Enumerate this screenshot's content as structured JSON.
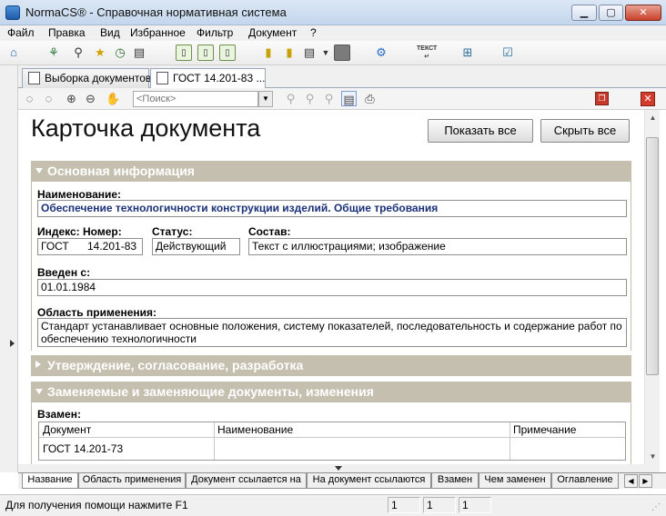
{
  "window": {
    "title": "NormaCS® - Справочная нормативная система",
    "minimize_glyph": "▁",
    "maximize_glyph": "▢",
    "close_glyph": "✕"
  },
  "menu": [
    "Файл",
    "Правка",
    "Вид",
    "Избранное",
    "Фильтр",
    "Документ",
    "?"
  ],
  "toolbar": {
    "text_button_label": "ТЕКСТ"
  },
  "tabs": [
    {
      "label": "Выборка документов",
      "active": false
    },
    {
      "label": "ГОСТ 14.201-83 ...",
      "active": true
    }
  ],
  "doc_toolbar": {
    "search_placeholder": "<Поиск>"
  },
  "card": {
    "title": "Карточка документа",
    "show_all_label": "Показать все",
    "hide_all_label": "Скрыть все"
  },
  "sections": {
    "main": {
      "title": "Основная информация",
      "expanded": true,
      "name_label": "Наименование:",
      "name_value": "Обеспечение технологичности конструкции изделий. Общие требования",
      "index_label": "Индекс: Номер:",
      "index_value": "ГОСТ",
      "number_value": "14.201-83",
      "status_label": "Статус:",
      "status_value": "Действующий",
      "composition_label": "Состав:",
      "composition_value": "Текст с иллюстрациями; изображение",
      "introduced_label": "Введен с:",
      "introduced_value": "01.01.1984",
      "scope_label": "Область применения:",
      "scope_value": "Стандарт устанавливает основные положения, систему показателей, последовательность и содержание работ по обеспечению технологичности"
    },
    "approval": {
      "title": "Утверждение, согласование, разработка",
      "expanded": false
    },
    "replacements": {
      "title": "Заменяемые и заменяющие документы, изменения",
      "expanded": true,
      "instead_label": "Взамен:",
      "columns": [
        "Документ",
        "Наименование",
        "Примечание"
      ],
      "rows": [
        [
          "ГОСТ 14.201-73",
          "",
          ""
        ]
      ]
    }
  },
  "bottom_tabs": [
    {
      "label": "Название",
      "active": true
    },
    {
      "label": "Область применения",
      "active": false
    },
    {
      "label": "Документ ссылается на",
      "active": false
    },
    {
      "label": "На документ ссылаются",
      "active": false
    },
    {
      "label": "Взамен",
      "active": false
    },
    {
      "label": "Чем заменен",
      "active": false
    },
    {
      "label": "Оглавление",
      "active": false
    }
  ],
  "status": {
    "text": "Для получения помощи нажмите F1",
    "fields": [
      "1",
      "1",
      "1"
    ]
  },
  "colors": {
    "section_header": "#c5bfb0",
    "name_text": "#1a3178",
    "close_button": "#c8412b"
  }
}
